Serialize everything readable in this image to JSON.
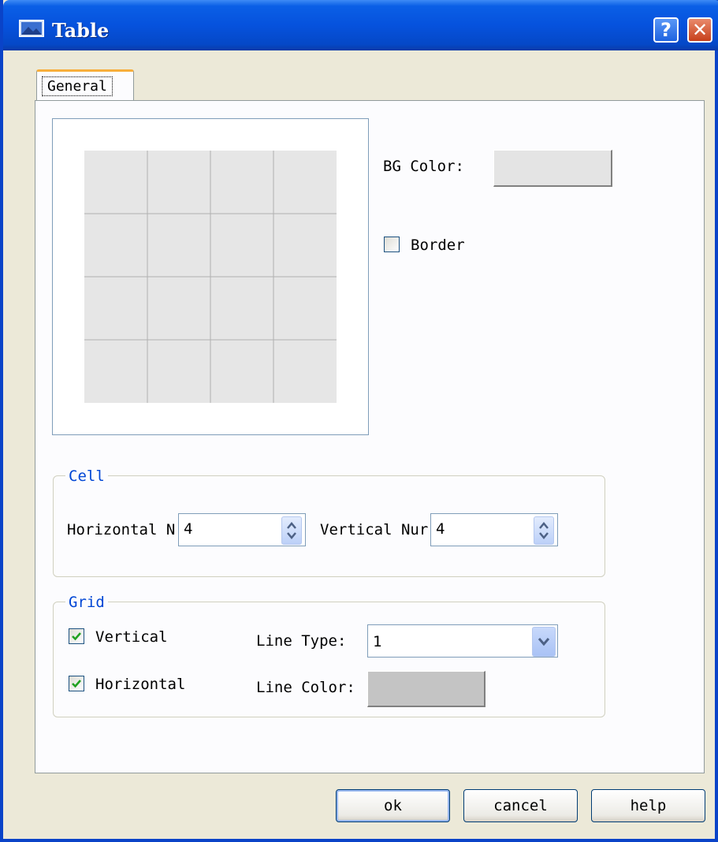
{
  "window": {
    "title": "Table"
  },
  "titlebar": {
    "help_glyph": "?",
    "close_glyph": "✕"
  },
  "tabs": [
    {
      "label": "General",
      "selected": true
    }
  ],
  "preview": {
    "rows": 4,
    "cols": 4,
    "cell_color": "#e6e6e6",
    "grid_color": "#b0b0b0"
  },
  "background": {
    "label": "BG Color:",
    "color": "#e4e4e4"
  },
  "border": {
    "label": "Border",
    "checked": false
  },
  "cell": {
    "title": "Cell",
    "horizontal_label": "Horizontal N",
    "horizontal_value": "4",
    "vertical_label": "Vertical Nur",
    "vertical_value": "4"
  },
  "grid": {
    "title": "Grid",
    "vertical": {
      "label": "Vertical",
      "checked": true
    },
    "horizontal": {
      "label": "Horizontal",
      "checked": true
    },
    "line_type_label": "Line Type:",
    "line_type_value": "1",
    "line_color_label": "Line Color:",
    "line_color": "#c4c4c4"
  },
  "buttons": {
    "ok": "ok",
    "cancel": "cancel",
    "help": "help"
  },
  "colors": {
    "titlebar": "#0652dd",
    "group_title": "#0046d5",
    "dialog_bg": "#ece9d8"
  }
}
